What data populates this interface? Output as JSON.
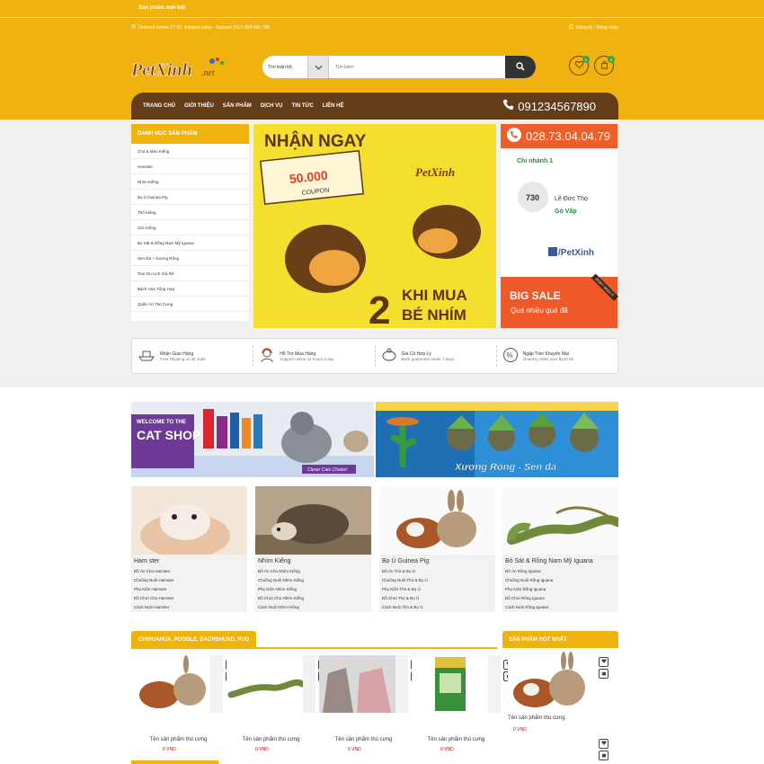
{
  "topbar": {
    "title": "Sản phẩm mới bật",
    "shipping_info": "Ordered before 17:30, shipped today - Support (012) 800 456 789",
    "account_links": "Đăng ký / Đăng nhập"
  },
  "header": {
    "logo_text": "PetXinh",
    "logo_suffix": ".net",
    "search_category": "Tìm toàn bộ",
    "search_placeholder": "Tìm kiếm",
    "wishlist_count": "0",
    "cart_count": "0"
  },
  "nav": {
    "items": [
      "TRANG CHỦ",
      "GIỚI THIỆU",
      "SẢN PHẨM",
      "DỊCH VỤ",
      "TIN TỨC",
      "LIÊN HỆ"
    ],
    "phone": "091234567890"
  },
  "categories": {
    "title": "DANH MỤC SẢN PHẨM",
    "items": [
      "Chó & Mèo Kiểng",
      "Hamster",
      "Nhím Kiểng",
      "Bọ Ú Guinea Pig",
      "Thỏ Kiểng",
      "Sóc Kiểng",
      "Bò Sát & Rồng Nam Mỹ Iguana",
      "Sen Đá – Xương Rồng",
      "Tour Du Lịch Giá Rẻ",
      "Bách Hóa Tổng Hợp",
      "Quần Áo Thú Cưng"
    ]
  },
  "promo": {
    "headline": "NHẬN NGAY",
    "coupon_value": "50.000",
    "coupon_label": "COUPON",
    "logo": "PetXinh",
    "number": "2",
    "line1": "KHI MUA",
    "line2": "BÉ NHÍM"
  },
  "side": {
    "hotline": "028.73.04.04.79",
    "branch_title": "Chi nhánh 1",
    "branch_number": "730",
    "branch_addr1": "Lê Đức Thọ",
    "branch_addr2": "Gò Vấp",
    "facebook": "/PetXinh",
    "sale_title": "BIG SALE",
    "sale_sub": "Quá nhiều quá đã",
    "sale_tag": "DON'T MISS IT"
  },
  "features": [
    {
      "title": "Nhận Giao Hàng",
      "sub": "Free shipping on all order"
    },
    {
      "title": "Hỗ Trợ Mua Hàng",
      "sub": "Support online 24 hours a day"
    },
    {
      "title": "Giá Cả Hợp Lý",
      "sub": "Back guarantee under 7 days"
    },
    {
      "title": "Ngập Tràn Khuyến Mại",
      "sub": "Onevery order over $120.00"
    }
  ],
  "banners": {
    "cat_welcome": "WELCOME TO THE",
    "cat_shop": "CAT SHOP",
    "cat_tag": "Clever Cats Choice!",
    "cactus_text": "Xương Rồng - Sen đá"
  },
  "cat_cards": [
    {
      "name": "Ham ster",
      "links": [
        "Đồ Ăn Cho Hamster",
        "Chuồng Nuôi Hamster",
        "Phụ Kiện Hamster",
        "Đồ Chơi Cho Hamster",
        "Cách Nuôi Hamster"
      ]
    },
    {
      "name": "Nhím Kiểng",
      "links": [
        "Đồ Ăn Cho Nhím Kiểng",
        "Chuồng Nuôi Nhím Kiểng",
        "Phụ Kiện Nhím Kiểng",
        "Đồ Chơi Cho Nhím Kiểng",
        "Cách Nuôi Nhím Kiểng"
      ]
    },
    {
      "name": "Bọ Ú Guinea Pig",
      "links": [
        "Đồ Ăn Thỏ & Bọ Ú",
        "Chuồng Nuôi Thỏ & Bọ Ú",
        "Phụ Kiện Thỏ & Bọ Ú",
        "Đồ Chơi Thỏ & Bọ Ú",
        "Cách Nuôi Thỏ & Bọ Ú"
      ]
    },
    {
      "name": "Bò Sát & Rồng Nam Mỹ Iguana",
      "links": [
        "Đồ Ăn Rồng Iguana",
        "Chuồng Nuôi Rồng Iguana",
        "Phụ Kiện Rồng Iguana",
        "Đồ Chơi Rồng Iguana",
        "Cách Nuôi Rồng Iguana"
      ]
    }
  ],
  "products_section": {
    "title": "CHIHUAHUA, POODLE, DACHSHUND, PUG",
    "items": [
      {
        "name": "Tên sản phẩm thú cưng",
        "price": "0 VND"
      },
      {
        "name": "Tên sản phẩm thú cưng",
        "price": "0 VND"
      },
      {
        "name": "Tên sản phẩm thú cưng",
        "price": "0 VND"
      },
      {
        "name": "Tên sản phẩm thú cưng",
        "price": "0 VND"
      }
    ]
  },
  "hot_section": {
    "title": "SẢN PHẨM HOT NHẤT",
    "item": {
      "name": "Tên sản phẩm thú cưng",
      "price": "0 VND"
    }
  },
  "colors": {
    "brand_yellow": "#efb20f",
    "nav_brown": "#623d18",
    "sale_orange": "#ef5828",
    "price_red": "#dd0000"
  }
}
